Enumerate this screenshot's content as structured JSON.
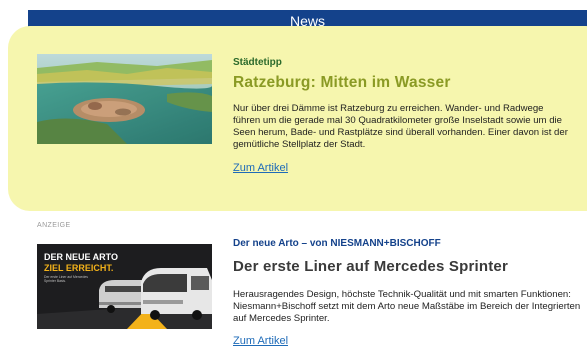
{
  "header": {
    "title": "News"
  },
  "articles": [
    {
      "kicker": "Städtetipp",
      "title": "Ratzeburg: Mitten im Wasser",
      "teaser": "Nur über drei Dämme ist Ratzeburg zu erreichen. Wander- und Radwege führen um die gerade mal 30 Quadratkilometer große Inselstadt sowie um die Seen herum, Bade- und Rastplätze sind überall vorhanden. Einer davon ist der gemütliche Stellplatz der Stadt.",
      "link": "Zum Artikel",
      "image_icon": "aerial-lake-town-photo"
    },
    {
      "ad_label": "ANZEIGE",
      "kicker": "Der neue Arto – von NIESMANN+BISCHOFF",
      "title": "Der erste Liner auf Mercedes Sprinter",
      "teaser": "Herausragendes Design, höchste Technik-Qualität und mit smarten Funktionen: Niesmann+Bischoff setzt mit dem Arto neue Maßstäbe im Bereich der Integrierten auf Mercedes Sprinter.",
      "link": "Zum Artikel",
      "image_icon": "motorhome-ad-photo",
      "ad_image": {
        "headline": "DER NEUE ARTO",
        "subline": "ZIEL ERREICHT.",
        "small_line_1": "Der erste Liner auf Mercedes",
        "small_line_2": "Sprinter Basis."
      }
    }
  ],
  "colors": {
    "header_bg": "#14428b",
    "highlight_bg": "#f6f6ae",
    "link": "#1e6bb8",
    "kicker_green": "#2b6a2b",
    "title_olive": "#8a9a24"
  }
}
